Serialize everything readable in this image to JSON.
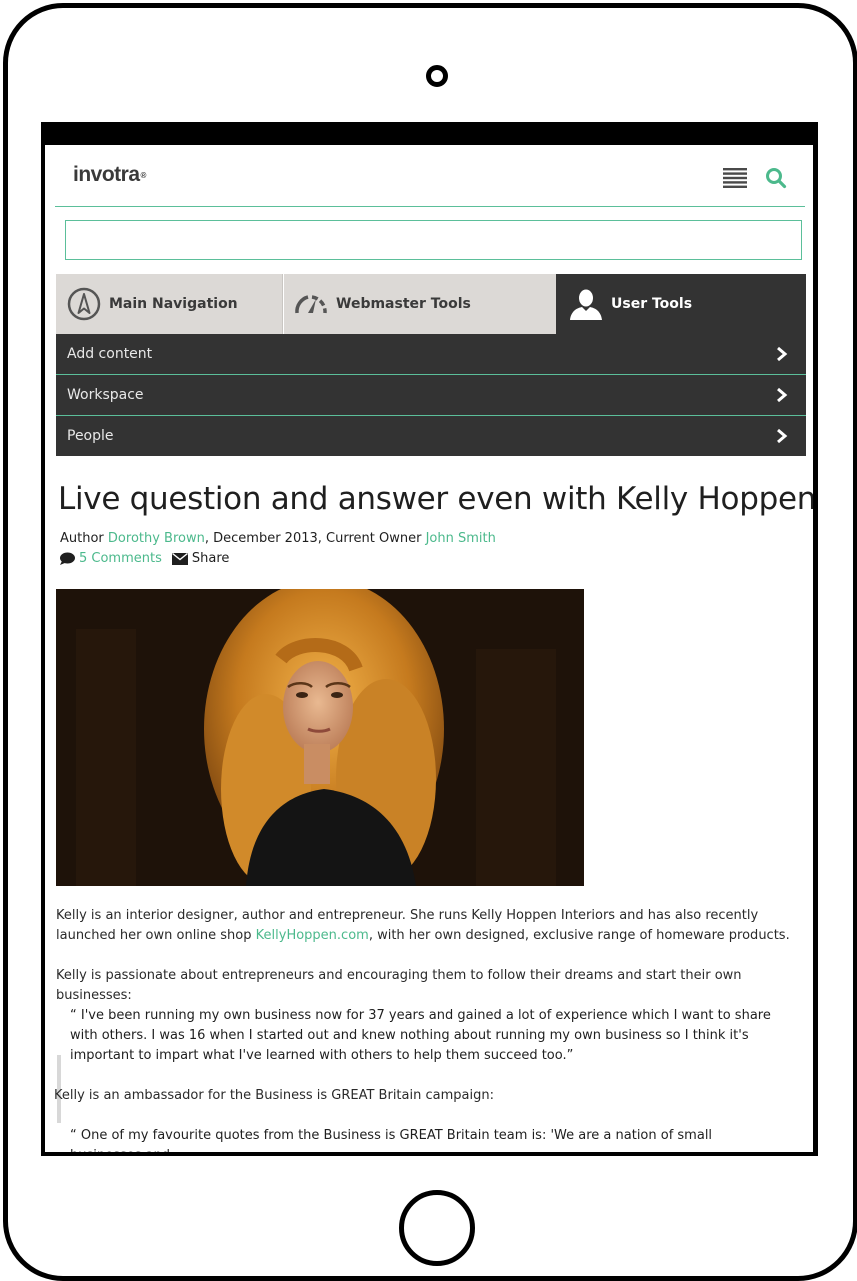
{
  "header": {
    "logo": "invotra",
    "logo_mark": "®"
  },
  "search": {
    "placeholder": ""
  },
  "tabs": [
    {
      "label": "Main Navigation",
      "icon": "compass-icon"
    },
    {
      "label": "Webmaster Tools",
      "icon": "gauge-icon"
    },
    {
      "label": "User Tools",
      "icon": "user-icon",
      "active": true
    }
  ],
  "menu": {
    "items": [
      {
        "label": "Add content"
      },
      {
        "label": "Workspace"
      },
      {
        "label": "People"
      }
    ]
  },
  "article": {
    "title": "Live question and answer even with Kelly Hoppen",
    "author_prefix": "Author",
    "author": "Dorothy Brown",
    "date_owner": ", December 2013, Current Owner",
    "owner": "John Smith",
    "comments": "5 Comments",
    "share": "Share",
    "p1_a": "Kelly is an interior designer, author and entrepreneur. She runs Kelly Hoppen Interiors and has also recently launched her own online shop",
    "p1_link": "KellyHoppen.com",
    "p1_b": ", with her own designed, exclusive range of homeware products.",
    "p2": "Kelly is passionate about entrepreneurs and encouraging them to follow their dreams and start their own businesses:",
    "quote1": "“ I've been running my own business now for 37 years and gained a lot of experience which I want to share with others. I was 16 when I started out and knew nothing about running my own business so I think it's important to impart what I've learned with others to help them succeed too.”",
    "p3": "Kelly is an ambassador for the Business is GREAT Britain campaign:",
    "quote2": "“ One of my favourite quotes from the Business is GREAT Britain team is: 'We are a nation of small businesses and"
  },
  "colors": {
    "accent": "#4cb98c",
    "dark_menu": "#333333",
    "tab_light": "#dcd9d6"
  }
}
